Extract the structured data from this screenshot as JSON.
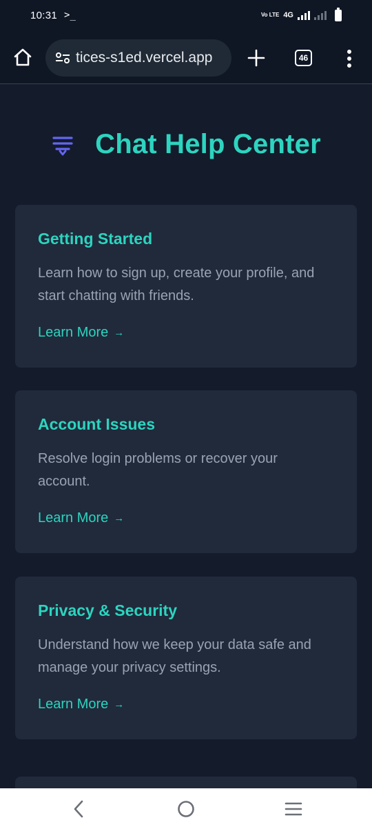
{
  "status_bar": {
    "time": "10:31",
    "prompt_glyph": ">_",
    "volte": "Vo LTE",
    "network": "4G",
    "icons": [
      "terminal-icon",
      "volte-icon",
      "signal-icon",
      "battery-icon"
    ]
  },
  "browser": {
    "url": "tices-s1ed.vercel.app",
    "tab_count": "46",
    "icons": [
      "home-icon",
      "site-settings-icon",
      "new-tab-icon",
      "tab-switcher-icon",
      "more-vert-icon"
    ]
  },
  "page": {
    "title": "Chat Help Center",
    "title_icon": "filter-lines-icon",
    "cards": [
      {
        "title": "Getting Started",
        "description": "Learn how to sign up, create your profile, and start chatting with friends.",
        "link_label": "Learn More",
        "link_arrow": "→"
      },
      {
        "title": "Account Issues",
        "description": "Resolve login problems or recover your account.",
        "link_label": "Learn More",
        "link_arrow": "→"
      },
      {
        "title": "Privacy & Security",
        "description": "Understand how we keep your data safe and manage your privacy settings.",
        "link_label": "Learn More",
        "link_arrow": "→"
      }
    ]
  },
  "nav_bar": {
    "icons": [
      "back-icon",
      "home-circle-icon",
      "recents-icon"
    ]
  },
  "colors": {
    "background": "#141b2b",
    "card": "#202a3b",
    "accent": "#2dd4bf",
    "icon_accent": "#6366f1",
    "body_text": "#9aa3b2"
  }
}
